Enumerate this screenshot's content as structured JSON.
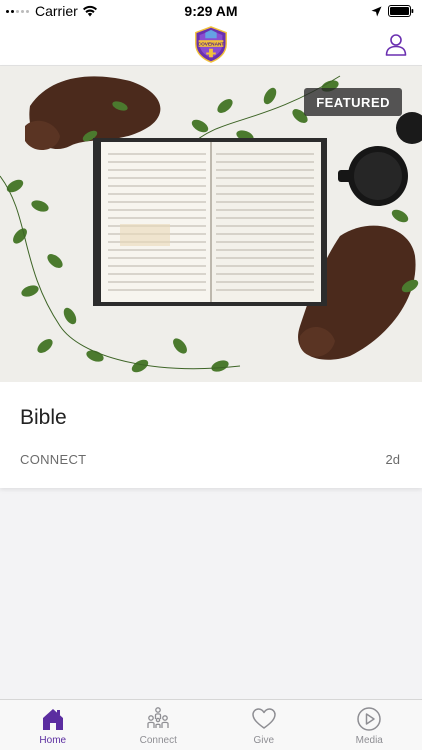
{
  "status_bar": {
    "carrier": "Carrier",
    "time": "9:29 AM"
  },
  "header": {
    "logo_text": "COVENANT",
    "logo_icon": "church-logo",
    "profile_icon": "user-icon"
  },
  "featured_card": {
    "badge": "FEATURED",
    "title": "Bible",
    "category": "CONNECT",
    "age": "2d",
    "image_description_icon": "open-bible-photo"
  },
  "tab_bar": {
    "tabs": [
      {
        "label": "Home",
        "icon": "home-icon",
        "active": true
      },
      {
        "label": "Connect",
        "icon": "people-icon",
        "active": false
      },
      {
        "label": "Give",
        "icon": "heart-icon",
        "active": false
      },
      {
        "label": "Media",
        "icon": "play-icon",
        "active": false
      }
    ]
  },
  "colors": {
    "accent": "#5b2da0",
    "inactive": "#8e8e93",
    "background": "#f3f3f5"
  }
}
